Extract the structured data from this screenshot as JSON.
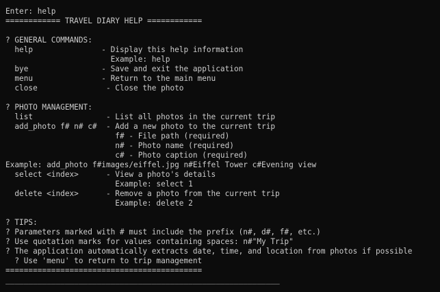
{
  "colors": {
    "background": "#0c0c0c",
    "text": "#cccccc"
  },
  "terminal": {
    "lines": [
      "Enter: help",
      "============ TRAVEL DIARY HELP ============",
      "",
      "? GENERAL COMMANDS:",
      "  help               - Display this help information",
      "                       Example: help",
      "  bye                - Save and exit the application",
      "  menu               - Return to the main menu",
      "  close               - Close the photo",
      "",
      "? PHOTO MANAGEMENT:",
      "  list                - List all photos in the current trip",
      "  add_photo f# n# c#  - Add a new photo to the current trip",
      "                        f# - File path (required)",
      "                        n# - Photo name (required)",
      "                        c# - Photo caption (required)",
      "Example: add_photo f#images/eiffel.jpg n#Eiffel Tower c#Evening view",
      "  select <index>      - View a photo's details",
      "                        Example: select 1",
      "  delete <index>      - Remove a photo from the current trip",
      "                        Example: delete 2",
      "",
      "? TIPS:",
      "? Parameters marked with # must include the prefix (n#, d#, f#, etc.)",
      "? Use quotation marks for values containing spaces: n#\"My Trip\"",
      "? The application automatically extracts date, time, and location from photos if possible",
      "  ? Use 'menu' to return to trip management",
      "===========================================",
      "____________________________________________________________"
    ]
  }
}
